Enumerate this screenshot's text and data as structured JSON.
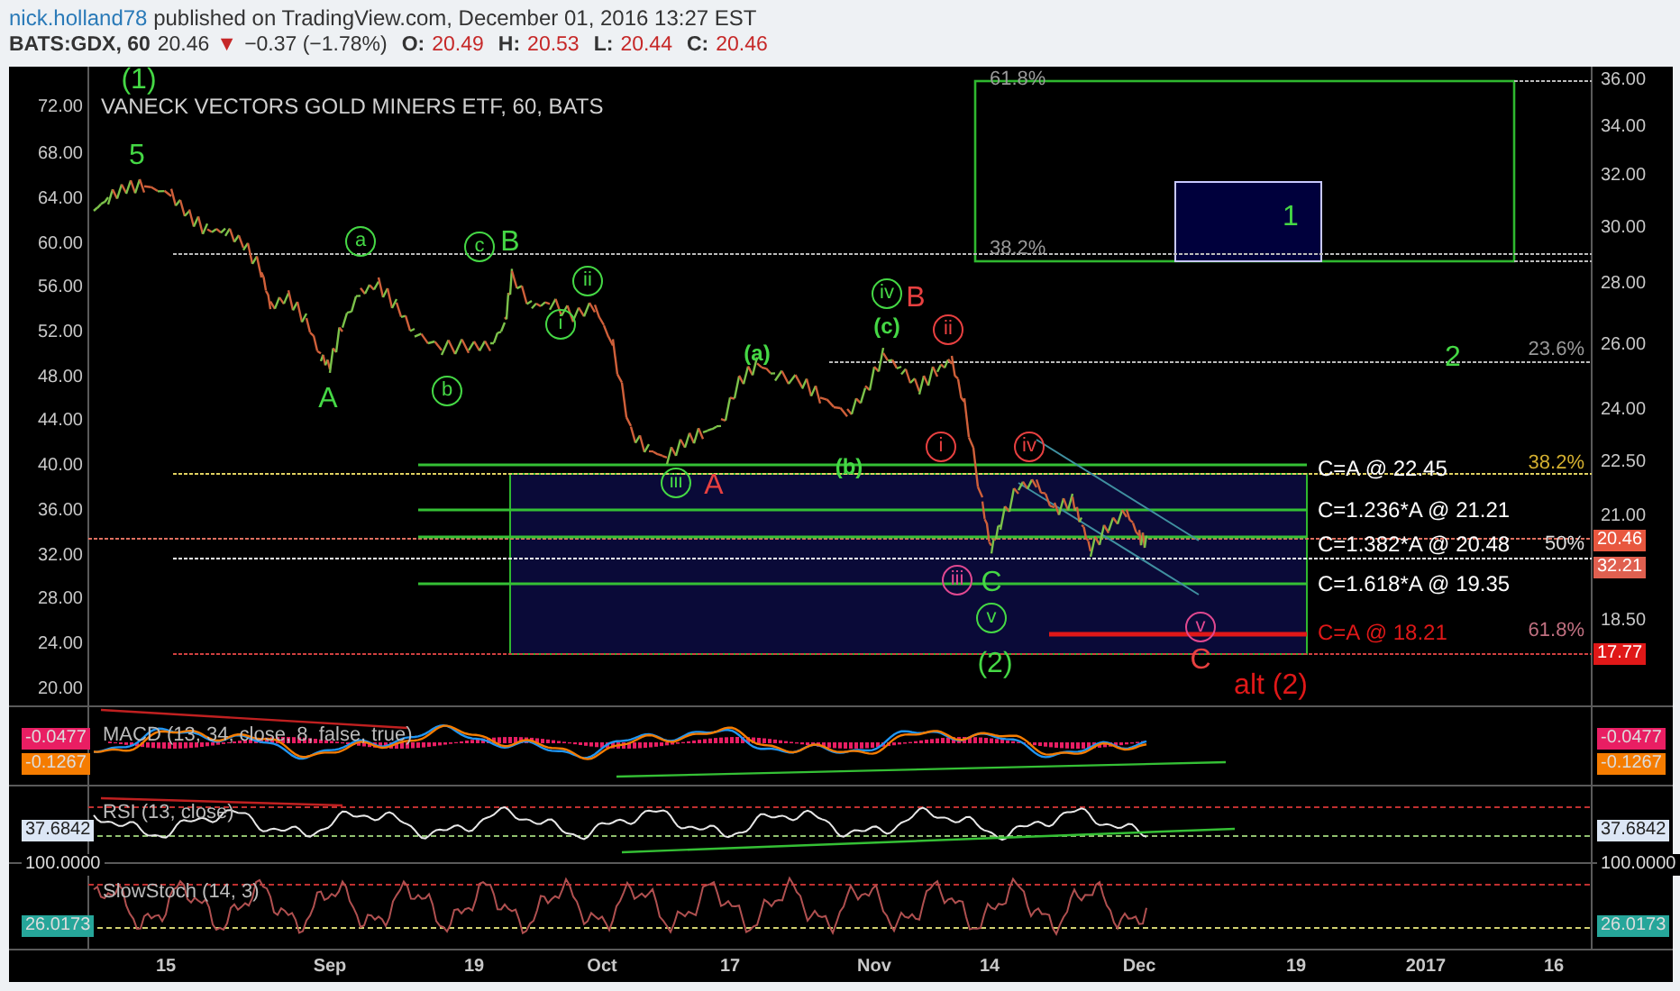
{
  "header": {
    "author": "nick.holland78",
    "byline": "published on TradingView.com, December 01, 2016 13:27 EST"
  },
  "quote": {
    "symbol": "BATS:GDX, 60",
    "last": "20.46",
    "arrow": "▼",
    "change": "−0.37 (−1.78%)",
    "ohlc": [
      {
        "label": "O:",
        "value": "20.49"
      },
      {
        "label": "H:",
        "value": "20.53"
      },
      {
        "label": "L:",
        "value": "20.44"
      },
      {
        "label": "C:",
        "value": "20.46"
      }
    ]
  },
  "chart": {
    "title": "VANECK VECTORS GOLD MINERS ETF, 60, BATS",
    "left_axis": [
      "72.00",
      "68.00",
      "64.00",
      "60.00",
      "56.00",
      "52.00",
      "48.00",
      "44.00",
      "40.00",
      "36.00",
      "32.00",
      "28.00",
      "24.00",
      "20.00"
    ],
    "right_axis": [
      "36.00",
      "34.00",
      "32.00",
      "30.00",
      "28.00",
      "26.00",
      "24.00",
      "22.50",
      "21.00",
      "18.50"
    ],
    "price_tags": [
      {
        "text": "20.46",
        "color": "#e8573f"
      },
      {
        "text": "32.21",
        "color": "#e06050"
      },
      {
        "text": "17.77",
        "color": "#e01818"
      }
    ],
    "wave_labels": [
      {
        "text": "(1)",
        "color": "#45d845",
        "kind": "large"
      },
      {
        "text": "5",
        "color": "#45d845",
        "kind": "large"
      },
      {
        "text": "A",
        "color": "#45d845",
        "kind": "large"
      },
      {
        "text": "a",
        "color": "#45d845",
        "kind": "circled"
      },
      {
        "text": "c",
        "color": "#45d845",
        "kind": "circled"
      },
      {
        "text": "B",
        "color": "#45d845",
        "kind": "large"
      },
      {
        "text": "b",
        "color": "#45d845",
        "kind": "circled"
      },
      {
        "text": "ii",
        "color": "#45d845",
        "kind": "circled"
      },
      {
        "text": "i",
        "color": "#45d845",
        "kind": "circled"
      },
      {
        "text": "iii",
        "color": "#45d845",
        "kind": "circled"
      },
      {
        "text": "A",
        "color": "#e84040",
        "kind": "large"
      },
      {
        "text": "(a)",
        "color": "#45d845",
        "kind": "small"
      },
      {
        "text": "(b)",
        "color": "#45d845",
        "kind": "small"
      },
      {
        "text": "iv",
        "color": "#45d845",
        "kind": "circled"
      },
      {
        "text": "B",
        "color": "#e84040",
        "kind": "large"
      },
      {
        "text": "(c)",
        "color": "#45d845",
        "kind": "small"
      },
      {
        "text": "ii",
        "color": "#e84040",
        "kind": "circled"
      },
      {
        "text": "i",
        "color": "#e84040",
        "kind": "circled"
      },
      {
        "text": "iv",
        "color": "#e84040",
        "kind": "circled"
      },
      {
        "text": "iii",
        "color": "#e04890",
        "kind": "circled"
      },
      {
        "text": "C",
        "color": "#45d845",
        "kind": "large"
      },
      {
        "text": "v",
        "color": "#45d845",
        "kind": "circled"
      },
      {
        "text": "(2)",
        "color": "#45d845",
        "kind": "large"
      },
      {
        "text": "v",
        "color": "#e04890",
        "kind": "circled"
      },
      {
        "text": "C",
        "color": "#e84040",
        "kind": "large"
      },
      {
        "text": "alt (2)",
        "color": "#e01818",
        "kind": "large"
      },
      {
        "text": "1",
        "color": "#45d845",
        "kind": "large"
      },
      {
        "text": "2",
        "color": "#45d845",
        "kind": "large"
      }
    ],
    "fib_labels": [
      {
        "text": "61.8%",
        "color": "#9a9a9a"
      },
      {
        "text": "38.2%",
        "color": "#9a9a9a"
      },
      {
        "text": "23.6%",
        "color": "#9a9a9a"
      },
      {
        "text": "38.2%",
        "color": "#d4b030"
      },
      {
        "text": "50%",
        "color": "#dddddd"
      },
      {
        "text": "61.8%",
        "color": "#c07080"
      }
    ],
    "targets": [
      {
        "text": "C=A @ 22.45",
        "color": "#ffffff"
      },
      {
        "text": "C=1.236*A @ 21.21",
        "color": "#ffffff"
      },
      {
        "text": "C=1.382*A @ 20.48",
        "color": "#ffffff"
      },
      {
        "text": "C=1.618*A @ 19.35",
        "color": "#ffffff"
      },
      {
        "text": "C=A @ 18.21",
        "color": "#e01818"
      }
    ]
  },
  "indicators": [
    {
      "title": "MACD (13, 34, close, 8, false, true)",
      "left_tags": [
        {
          "text": "-0.0477",
          "color": "#e91e63"
        },
        {
          "text": "-0.1267",
          "color": "#f57c00"
        }
      ],
      "right_tags": [
        {
          "text": "-0.0477",
          "color": "#e91e63"
        },
        {
          "text": "-0.1267",
          "color": "#f57c00"
        }
      ]
    },
    {
      "title": "RSI (13, close)",
      "left_tags": [
        {
          "text": "37.6842",
          "color": "#dce6f5"
        },
        {
          "text": "100.0000",
          "color": "#000000"
        }
      ],
      "right_tags": [
        {
          "text": "37.6842",
          "color": "#dce6f5"
        },
        {
          "text": "100.0000",
          "color": "#000000"
        }
      ]
    },
    {
      "title": "SlowStoch (14, 3)",
      "left_tags": [
        {
          "text": "26.0173",
          "color": "#26a69a"
        }
      ],
      "right_tags": [
        {
          "text": "26.0173",
          "color": "#26a69a"
        }
      ]
    }
  ],
  "time_axis": [
    "15",
    "Sep",
    "19",
    "Oct",
    "17",
    "Nov",
    "14",
    "Dec",
    "19",
    "2017",
    "16"
  ]
}
